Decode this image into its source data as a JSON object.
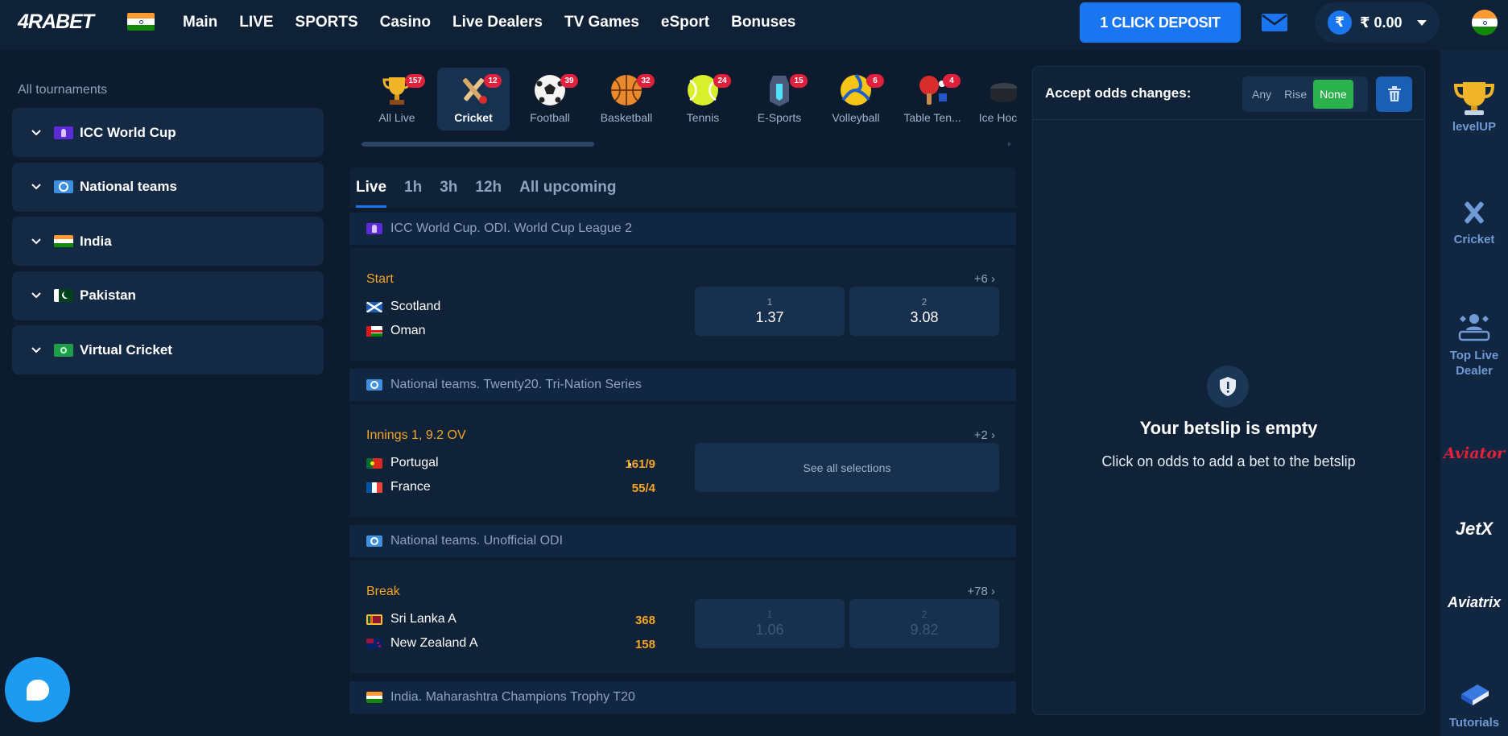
{
  "header": {
    "logo": "4RABET",
    "nav": [
      "Main",
      "LIVE",
      "SPORTS",
      "Casino",
      "Live Dealers",
      "TV Games",
      "eSport",
      "Bonuses"
    ],
    "deposit_label": "1 CLICK DEPOSIT",
    "currency_symbol": "₹",
    "balance": "₹ 0.00"
  },
  "sidebar": {
    "title": "All tournaments",
    "items": [
      {
        "label": "ICC World Cup",
        "icon": "icc-icon"
      },
      {
        "label": "National teams",
        "icon": "globe-icon"
      },
      {
        "label": "India",
        "icon": "india-flag-icon"
      },
      {
        "label": "Pakistan",
        "icon": "pakistan-flag-icon"
      },
      {
        "label": "Virtual Cricket",
        "icon": "virtual-cricket-icon"
      }
    ]
  },
  "sports": [
    {
      "label": "All Live",
      "count": "157",
      "icon": "trophy-icon"
    },
    {
      "label": "Cricket",
      "count": "12",
      "icon": "cricket-icon",
      "active": true
    },
    {
      "label": "Football",
      "count": "39",
      "icon": "football-icon"
    },
    {
      "label": "Basketball",
      "count": "32",
      "icon": "basketball-icon"
    },
    {
      "label": "Tennis",
      "count": "24",
      "icon": "tennis-icon"
    },
    {
      "label": "E-Sports",
      "count": "15",
      "icon": "esports-icon"
    },
    {
      "label": "Volleyball",
      "count": "6",
      "icon": "volleyball-icon"
    },
    {
      "label": "Table Ten...",
      "count": "4",
      "icon": "table-tennis-icon"
    },
    {
      "label": "Ice Hock",
      "count": "",
      "icon": "ice-hockey-icon"
    }
  ],
  "time_tabs": [
    "Live",
    "1h",
    "3h",
    "12h",
    "All upcoming"
  ],
  "leagues": [
    {
      "name": "ICC World Cup. ODI. World Cup League 2",
      "match": {
        "status": "Start",
        "more": "+6",
        "team1": "Scotland",
        "team2": "Oman",
        "odds": [
          {
            "label": "1",
            "value": "1.37"
          },
          {
            "label": "2",
            "value": "3.08"
          }
        ]
      }
    },
    {
      "name": "National teams. Twenty20. Tri-Nation Series",
      "match": {
        "status": "Innings 1, 9.2 OV",
        "more": "+2",
        "team1": "Portugal",
        "team2": "France",
        "score1": "161/9",
        "score2": "55/4",
        "see_all": "See all selections"
      }
    },
    {
      "name": "National teams. Unofficial ODI",
      "match": {
        "status": "Break",
        "more": "+78",
        "team1": "Sri Lanka A",
        "team2": "New Zealand A",
        "score1": "368",
        "score2": "158",
        "odds": [
          {
            "label": "1",
            "value": "1.06"
          },
          {
            "label": "2",
            "value": "9.82"
          }
        ]
      }
    },
    {
      "name": "India. Maharashtra Champions Trophy T20"
    }
  ],
  "betslip": {
    "title": "Accept odds changes:",
    "options": [
      "Any",
      "Rise",
      "None"
    ],
    "selected": "None",
    "empty_title": "Your betslip is empty",
    "empty_sub": "Click on odds to add a bet to the betslip"
  },
  "rail": {
    "levelup": "levelUP",
    "cricket": "Cricket",
    "top_live_dealer": "Top Live Dealer",
    "aviator": "Aviator",
    "jetx": "JetX",
    "aviatrix": "Aviatrix",
    "tutorials": "Tutorials"
  },
  "colors": {
    "background": "#0d1b2e",
    "accent": "#1a76f0",
    "status": "#f5a623",
    "badge": "#e0213d",
    "selected_option": "#2bb24c"
  }
}
